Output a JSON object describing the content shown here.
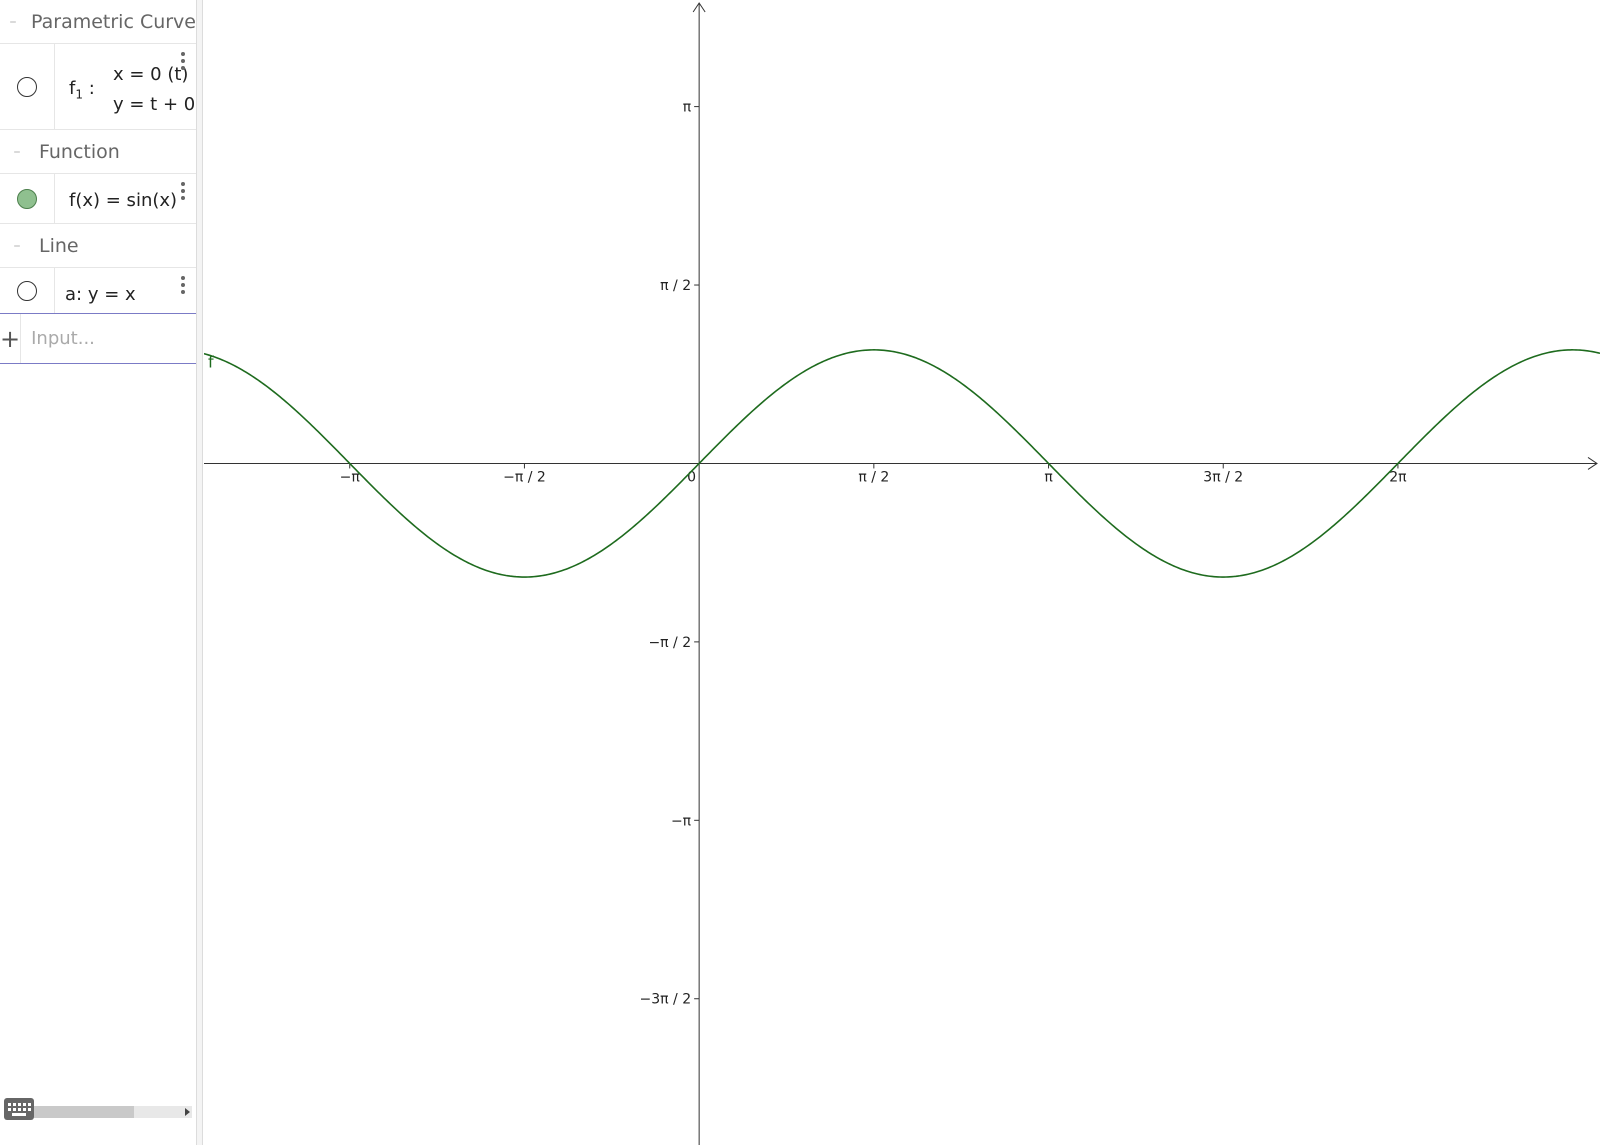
{
  "algebra": {
    "categories": [
      {
        "label": "Parametric Curve",
        "toggle": "–",
        "items": [
          {
            "name_base": "f",
            "name_sub": "1",
            "name_suffix": " :",
            "line1": "x = 0 (t)",
            "line2": "y = t + 0",
            "visible": false
          }
        ]
      },
      {
        "label": "Function",
        "toggle": "–",
        "items": [
          {
            "text": "f(x)  =  sin(x)",
            "visible": true
          }
        ]
      },
      {
        "label": "Line",
        "toggle": "–",
        "items": [
          {
            "text": "a: y = x",
            "visible": false
          }
        ]
      }
    ],
    "input": {
      "plus": "+",
      "placeholder": "Input..."
    }
  },
  "graph": {
    "curve_label": "f",
    "x_tick_labels": [
      "−π",
      "−π / 2",
      "0",
      "π / 2",
      "π",
      "3π / 2",
      "2π"
    ],
    "y_tick_labels": [
      "π",
      "π / 2",
      "−π / 2",
      "−π",
      "−3π / 2"
    ],
    "curve_color": "#1e6b1e",
    "axis_color": "#333333"
  },
  "chart_data": {
    "type": "line",
    "title": "",
    "xlabel": "",
    "ylabel": "",
    "x_unit": "π/2",
    "series": [
      {
        "name": "f",
        "function": "sin(x)"
      }
    ],
    "xlim": [
      -4.452,
      8.1
    ],
    "ylim": [
      -6.0,
      4.08
    ],
    "grid": false
  }
}
